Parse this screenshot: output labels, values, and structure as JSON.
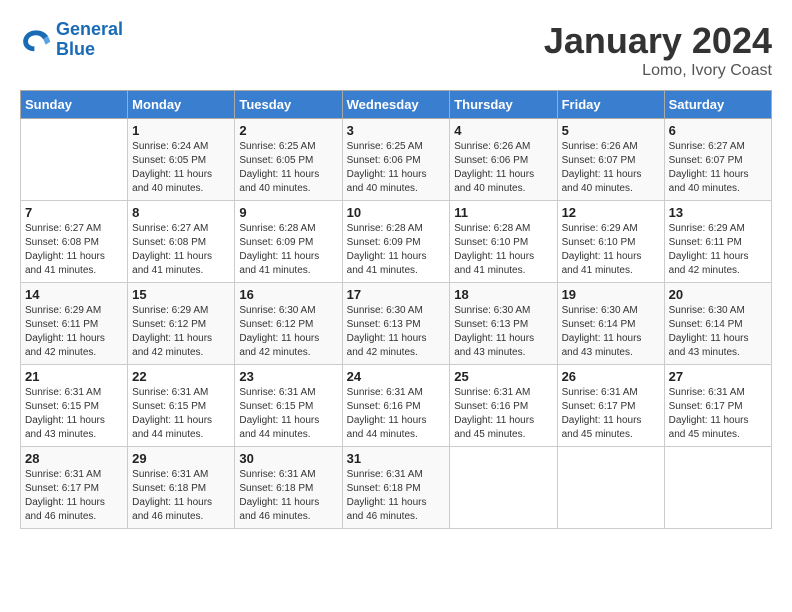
{
  "logo": {
    "text_general": "General",
    "text_blue": "Blue"
  },
  "title": "January 2024",
  "location": "Lomo, Ivory Coast",
  "days_header": [
    "Sunday",
    "Monday",
    "Tuesday",
    "Wednesday",
    "Thursday",
    "Friday",
    "Saturday"
  ],
  "weeks": [
    [
      {
        "day": "",
        "sunrise": "",
        "sunset": "",
        "daylight": ""
      },
      {
        "day": "1",
        "sunrise": "Sunrise: 6:24 AM",
        "sunset": "Sunset: 6:05 PM",
        "daylight": "Daylight: 11 hours and 40 minutes."
      },
      {
        "day": "2",
        "sunrise": "Sunrise: 6:25 AM",
        "sunset": "Sunset: 6:05 PM",
        "daylight": "Daylight: 11 hours and 40 minutes."
      },
      {
        "day": "3",
        "sunrise": "Sunrise: 6:25 AM",
        "sunset": "Sunset: 6:06 PM",
        "daylight": "Daylight: 11 hours and 40 minutes."
      },
      {
        "day": "4",
        "sunrise": "Sunrise: 6:26 AM",
        "sunset": "Sunset: 6:06 PM",
        "daylight": "Daylight: 11 hours and 40 minutes."
      },
      {
        "day": "5",
        "sunrise": "Sunrise: 6:26 AM",
        "sunset": "Sunset: 6:07 PM",
        "daylight": "Daylight: 11 hours and 40 minutes."
      },
      {
        "day": "6",
        "sunrise": "Sunrise: 6:27 AM",
        "sunset": "Sunset: 6:07 PM",
        "daylight": "Daylight: 11 hours and 40 minutes."
      }
    ],
    [
      {
        "day": "7",
        "sunrise": "Sunrise: 6:27 AM",
        "sunset": "Sunset: 6:08 PM",
        "daylight": "Daylight: 11 hours and 41 minutes."
      },
      {
        "day": "8",
        "sunrise": "Sunrise: 6:27 AM",
        "sunset": "Sunset: 6:08 PM",
        "daylight": "Daylight: 11 hours and 41 minutes."
      },
      {
        "day": "9",
        "sunrise": "Sunrise: 6:28 AM",
        "sunset": "Sunset: 6:09 PM",
        "daylight": "Daylight: 11 hours and 41 minutes."
      },
      {
        "day": "10",
        "sunrise": "Sunrise: 6:28 AM",
        "sunset": "Sunset: 6:09 PM",
        "daylight": "Daylight: 11 hours and 41 minutes."
      },
      {
        "day": "11",
        "sunrise": "Sunrise: 6:28 AM",
        "sunset": "Sunset: 6:10 PM",
        "daylight": "Daylight: 11 hours and 41 minutes."
      },
      {
        "day": "12",
        "sunrise": "Sunrise: 6:29 AM",
        "sunset": "Sunset: 6:10 PM",
        "daylight": "Daylight: 11 hours and 41 minutes."
      },
      {
        "day": "13",
        "sunrise": "Sunrise: 6:29 AM",
        "sunset": "Sunset: 6:11 PM",
        "daylight": "Daylight: 11 hours and 42 minutes."
      }
    ],
    [
      {
        "day": "14",
        "sunrise": "Sunrise: 6:29 AM",
        "sunset": "Sunset: 6:11 PM",
        "daylight": "Daylight: 11 hours and 42 minutes."
      },
      {
        "day": "15",
        "sunrise": "Sunrise: 6:29 AM",
        "sunset": "Sunset: 6:12 PM",
        "daylight": "Daylight: 11 hours and 42 minutes."
      },
      {
        "day": "16",
        "sunrise": "Sunrise: 6:30 AM",
        "sunset": "Sunset: 6:12 PM",
        "daylight": "Daylight: 11 hours and 42 minutes."
      },
      {
        "day": "17",
        "sunrise": "Sunrise: 6:30 AM",
        "sunset": "Sunset: 6:13 PM",
        "daylight": "Daylight: 11 hours and 42 minutes."
      },
      {
        "day": "18",
        "sunrise": "Sunrise: 6:30 AM",
        "sunset": "Sunset: 6:13 PM",
        "daylight": "Daylight: 11 hours and 43 minutes."
      },
      {
        "day": "19",
        "sunrise": "Sunrise: 6:30 AM",
        "sunset": "Sunset: 6:14 PM",
        "daylight": "Daylight: 11 hours and 43 minutes."
      },
      {
        "day": "20",
        "sunrise": "Sunrise: 6:30 AM",
        "sunset": "Sunset: 6:14 PM",
        "daylight": "Daylight: 11 hours and 43 minutes."
      }
    ],
    [
      {
        "day": "21",
        "sunrise": "Sunrise: 6:31 AM",
        "sunset": "Sunset: 6:15 PM",
        "daylight": "Daylight: 11 hours and 43 minutes."
      },
      {
        "day": "22",
        "sunrise": "Sunrise: 6:31 AM",
        "sunset": "Sunset: 6:15 PM",
        "daylight": "Daylight: 11 hours and 44 minutes."
      },
      {
        "day": "23",
        "sunrise": "Sunrise: 6:31 AM",
        "sunset": "Sunset: 6:15 PM",
        "daylight": "Daylight: 11 hours and 44 minutes."
      },
      {
        "day": "24",
        "sunrise": "Sunrise: 6:31 AM",
        "sunset": "Sunset: 6:16 PM",
        "daylight": "Daylight: 11 hours and 44 minutes."
      },
      {
        "day": "25",
        "sunrise": "Sunrise: 6:31 AM",
        "sunset": "Sunset: 6:16 PM",
        "daylight": "Daylight: 11 hours and 45 minutes."
      },
      {
        "day": "26",
        "sunrise": "Sunrise: 6:31 AM",
        "sunset": "Sunset: 6:17 PM",
        "daylight": "Daylight: 11 hours and 45 minutes."
      },
      {
        "day": "27",
        "sunrise": "Sunrise: 6:31 AM",
        "sunset": "Sunset: 6:17 PM",
        "daylight": "Daylight: 11 hours and 45 minutes."
      }
    ],
    [
      {
        "day": "28",
        "sunrise": "Sunrise: 6:31 AM",
        "sunset": "Sunset: 6:17 PM",
        "daylight": "Daylight: 11 hours and 46 minutes."
      },
      {
        "day": "29",
        "sunrise": "Sunrise: 6:31 AM",
        "sunset": "Sunset: 6:18 PM",
        "daylight": "Daylight: 11 hours and 46 minutes."
      },
      {
        "day": "30",
        "sunrise": "Sunrise: 6:31 AM",
        "sunset": "Sunset: 6:18 PM",
        "daylight": "Daylight: 11 hours and 46 minutes."
      },
      {
        "day": "31",
        "sunrise": "Sunrise: 6:31 AM",
        "sunset": "Sunset: 6:18 PM",
        "daylight": "Daylight: 11 hours and 46 minutes."
      },
      {
        "day": "",
        "sunrise": "",
        "sunset": "",
        "daylight": ""
      },
      {
        "day": "",
        "sunrise": "",
        "sunset": "",
        "daylight": ""
      },
      {
        "day": "",
        "sunrise": "",
        "sunset": "",
        "daylight": ""
      }
    ]
  ]
}
